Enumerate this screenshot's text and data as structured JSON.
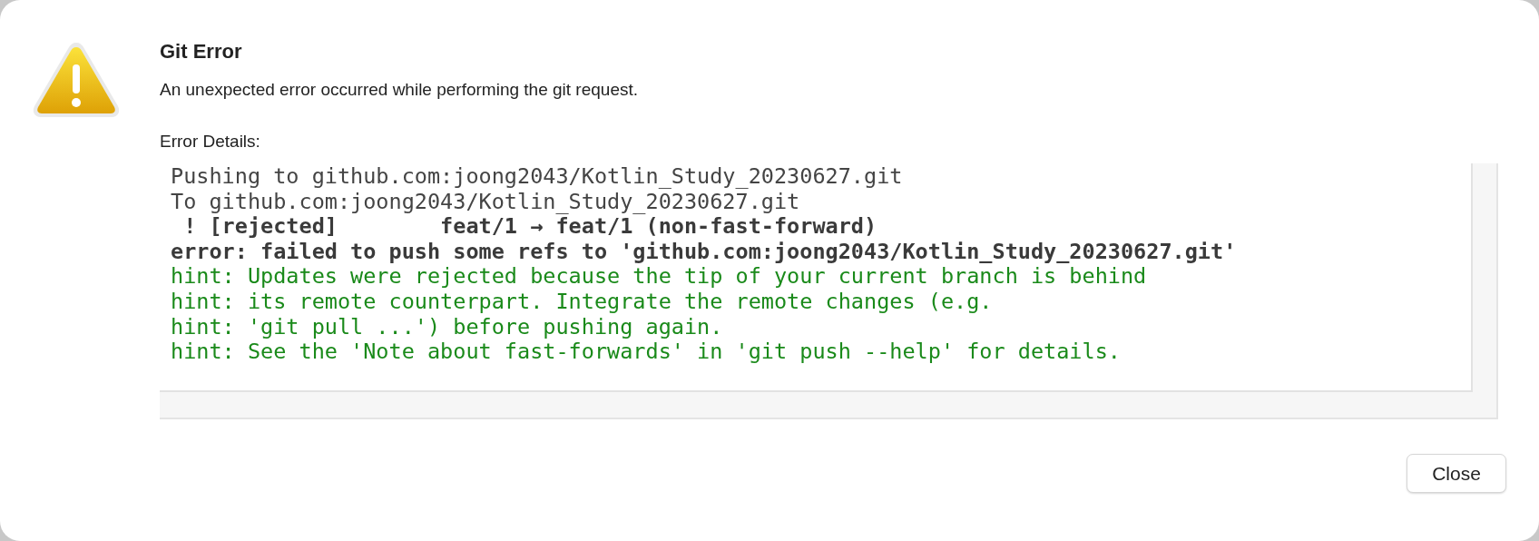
{
  "dialog": {
    "title": "Git Error",
    "message": "An unexpected error occurred while performing the git request.",
    "details_label": "Error Details:",
    "log": [
      {
        "kind": "normal",
        "text": "Pushing to github.com:joong2043/Kotlin_Study_20230627.git"
      },
      {
        "kind": "normal",
        "text": "To github.com:joong2043/Kotlin_Study_20230627.git"
      },
      {
        "kind": "bold",
        "text": " ! [rejected]        feat/1 → feat/1 (non-fast-forward)"
      },
      {
        "kind": "bold",
        "text": "error: failed to push some refs to 'github.com:joong2043/Kotlin_Study_20230627.git'"
      },
      {
        "kind": "hint",
        "text": "hint: Updates were rejected because the tip of your current branch is behind"
      },
      {
        "kind": "hint",
        "text": "hint: its remote counterpart. Integrate the remote changes (e.g."
      },
      {
        "kind": "hint",
        "text": "hint: 'git pull ...') before pushing again."
      },
      {
        "kind": "hint",
        "text": "hint: See the 'Note about fast-forwards' in 'git push --help' for details."
      }
    ],
    "buttons": [
      "Close"
    ]
  }
}
